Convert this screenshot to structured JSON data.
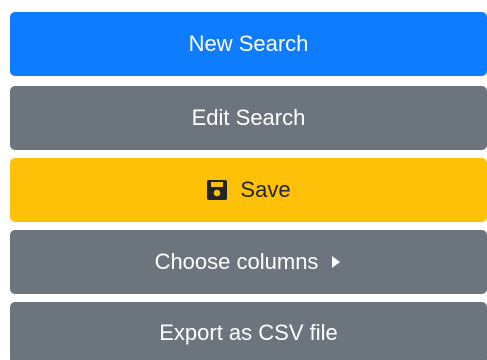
{
  "menu": {
    "new_search": {
      "label": "New Search"
    },
    "edit_search": {
      "label": "Edit Search"
    },
    "save": {
      "label": "Save",
      "icon": "floppy-disk-icon"
    },
    "choose_columns": {
      "label": "Choose columns",
      "icon": "caret-right-icon"
    },
    "export_csv": {
      "label": "Export as CSV file"
    }
  },
  "colors": {
    "primary": "#0d7cff",
    "secondary": "#6c757d",
    "warning": "#ffc107",
    "warning_text": "#212529",
    "light_text": "#ffffff"
  }
}
